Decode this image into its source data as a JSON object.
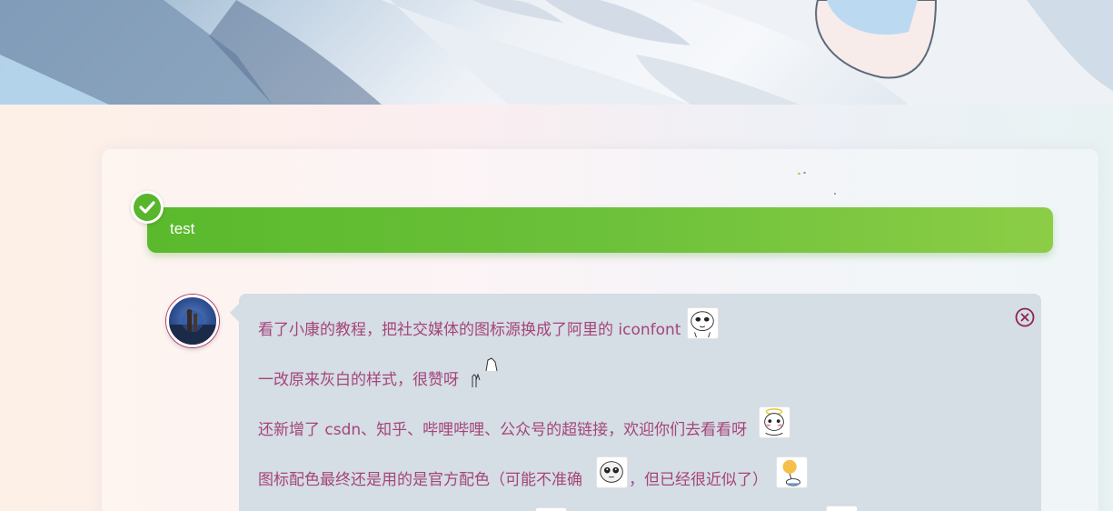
{
  "banner": {
    "text": "test",
    "color": "#6cc13a"
  },
  "comment": {
    "lines": [
      "看了小康的教程，把社交媒体的图标源换成了阿里的 iconfont",
      "一改原来灰白的样式，很赞呀",
      "还新增了 csdn、知乎、哔哩哔哩、公众号的超链接，欢迎你们去看看呀",
      "图标配色最终还是用的是官方配色（可能不准确",
      "，但已经很近似了）"
    ],
    "text_color": "#a4457a",
    "bubble_color": "#d5dde5"
  },
  "icons": {
    "check": "check-icon",
    "close": "close-circle-icon"
  }
}
